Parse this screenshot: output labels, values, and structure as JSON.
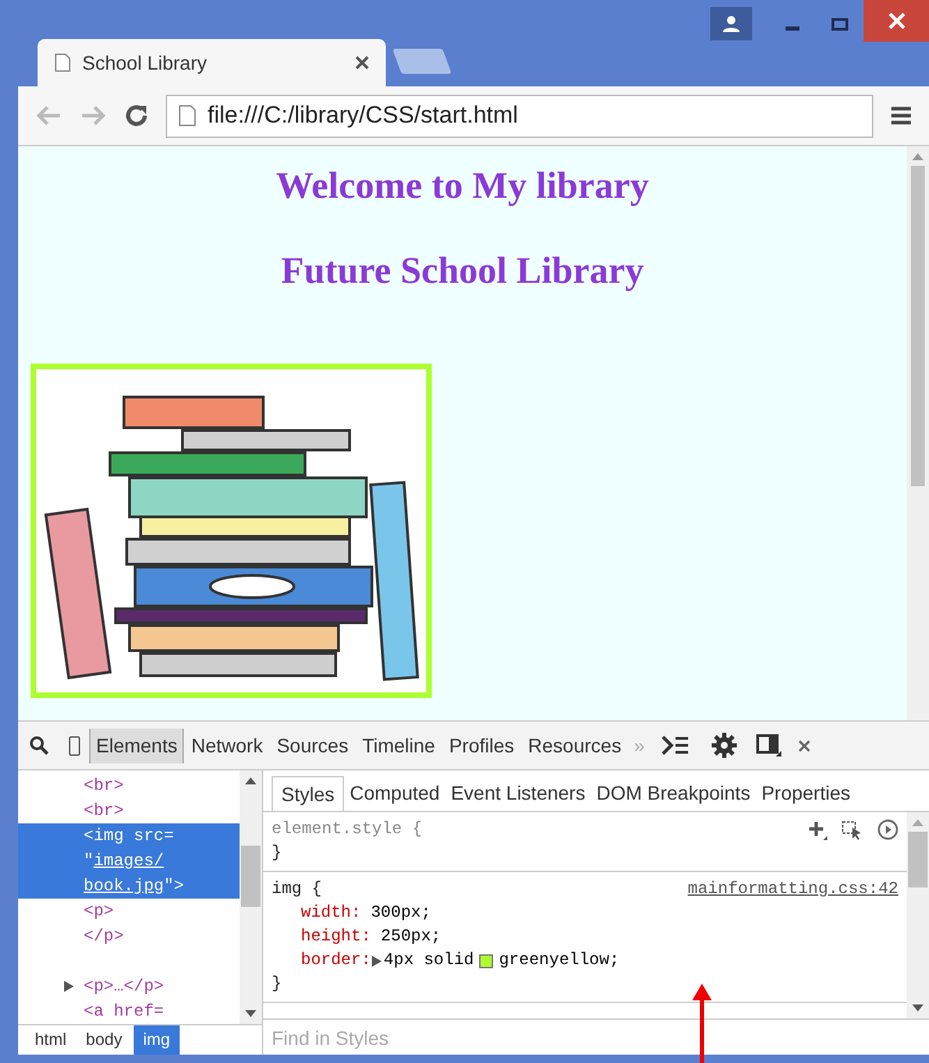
{
  "browser": {
    "tab_title": "School Library",
    "address": "file:///C:/library/CSS/start.html"
  },
  "page": {
    "headings": [
      "Welcome to My library",
      "Future School Library"
    ]
  },
  "devtools": {
    "panels": [
      {
        "label": "Elements",
        "selected": true
      },
      {
        "label": "Network",
        "selected": false
      },
      {
        "label": "Sources",
        "selected": false
      },
      {
        "label": "Timeline",
        "selected": false
      },
      {
        "label": "Profiles",
        "selected": false
      },
      {
        "label": "Resources",
        "selected": false
      }
    ],
    "more": "»",
    "dom": [
      {
        "kind": "tag",
        "text": "<br>",
        "selected": false
      },
      {
        "kind": "tag",
        "text": "<br>",
        "selected": false
      },
      {
        "kind": "img",
        "open": "<img src=",
        "quote": "\"",
        "link": [
          "images/",
          "book.jpg"
        ],
        "close": "\">",
        "selected": true
      },
      {
        "kind": "tag",
        "text": "<p>",
        "selected": false
      },
      {
        "kind": "tag",
        "text": "</p>",
        "selected": false
      },
      {
        "kind": "collapsed",
        "text": "<p>…</p>",
        "selected": false
      },
      {
        "kind": "tag",
        "text": "<a href=",
        "selected": false
      }
    ],
    "breadcrumbs": [
      {
        "label": "html",
        "selected": false
      },
      {
        "label": "body",
        "selected": false
      },
      {
        "label": "img",
        "selected": true
      }
    ],
    "sidebar_tabs": [
      {
        "label": "Styles",
        "selected": true
      },
      {
        "label": "Computed",
        "selected": false
      },
      {
        "label": "Event Listeners",
        "selected": false
      },
      {
        "label": "DOM Breakpoints",
        "selected": false
      },
      {
        "label": "Properties",
        "selected": false
      }
    ],
    "rules": [
      {
        "selector": "element.style {",
        "close": "}"
      },
      {
        "selector": "img {",
        "source": "mainformatting.css:42",
        "close": "}",
        "properties": [
          {
            "name": "width:",
            "value": "300px;"
          },
          {
            "name": "height:",
            "value": "250px;"
          },
          {
            "name": "border:",
            "expandable": true,
            "value": "4px solid",
            "color": "#adff2f",
            "swatch_value": "greenyellow;"
          }
        ]
      }
    ],
    "filter": {
      "placeholder": "Find in Styles"
    }
  }
}
